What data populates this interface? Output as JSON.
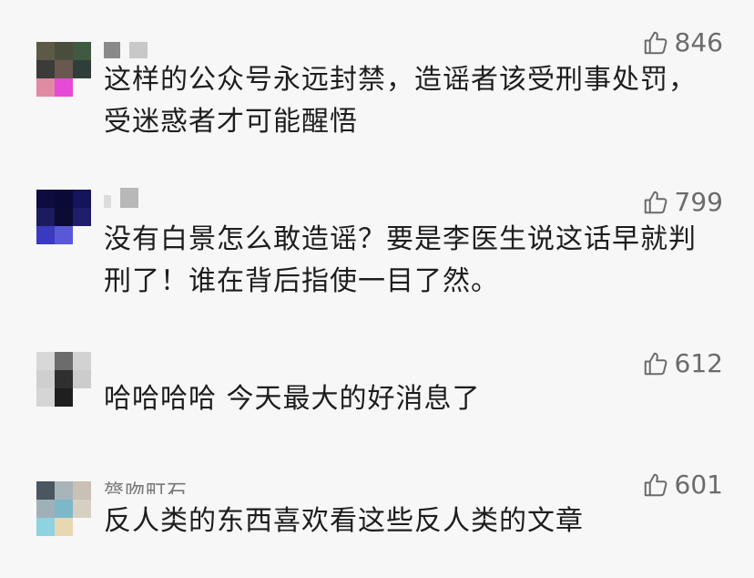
{
  "comments": [
    {
      "likes": "846",
      "text_lines": [
        "这样的公众号永远封禁，造谣者该受刑事处罚，",
        "受迷惑者才可能醒悟"
      ]
    },
    {
      "likes": "799",
      "text_lines": [
        "没有白景怎么敢造谣？要是李医生说这话早就判",
        "刑了！谁在背后指使一目了然。"
      ]
    },
    {
      "likes": "612",
      "text_lines": [
        "哈哈哈哈 今天最大的好消息了"
      ]
    },
    {
      "username": "膂吻町石",
      "likes": "601",
      "text_lines": [
        "反人类的东西喜欢看这些反人类的文章"
      ]
    }
  ],
  "icons": {
    "like": "thumbs-up-icon"
  },
  "colors": {
    "background": "#f7f7f7",
    "text": "#1d1d1d",
    "meta": "#6b6b6b"
  }
}
